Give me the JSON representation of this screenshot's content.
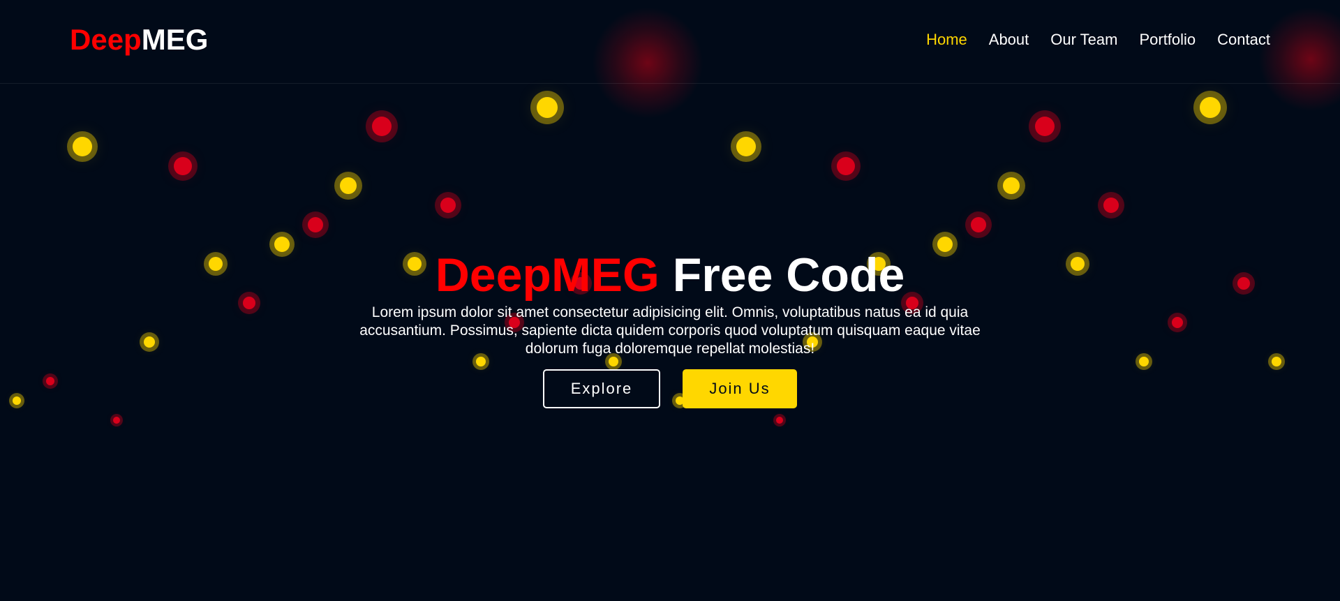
{
  "brand": {
    "logo_part1": "Deep",
    "logo_part2": "MEG"
  },
  "nav": {
    "items": [
      {
        "label": "Home",
        "active": true
      },
      {
        "label": "About",
        "active": false
      },
      {
        "label": "Our Team",
        "active": false
      },
      {
        "label": "Portfolio",
        "active": false
      },
      {
        "label": "Contact",
        "active": false
      }
    ]
  },
  "hero": {
    "title_part1": "DeepMEG",
    "title_part2": "Free Code",
    "description": "Lorem ipsum dolor sit amet consectetur adipisicing elit. Omnis, voluptatibus natus ea id quia accusantium. Possimus, sapiente dicta quidem corporis quod voluptatum quisquam eaque vitae dolorum fuga doloremque repellat molestias!",
    "explore_label": "Explore",
    "join_label": "Join Us"
  },
  "colors": {
    "background": "#010a18",
    "brand_red": "#ff0000",
    "accent_yellow": "#ffd700",
    "light_red": "#d9001b"
  }
}
